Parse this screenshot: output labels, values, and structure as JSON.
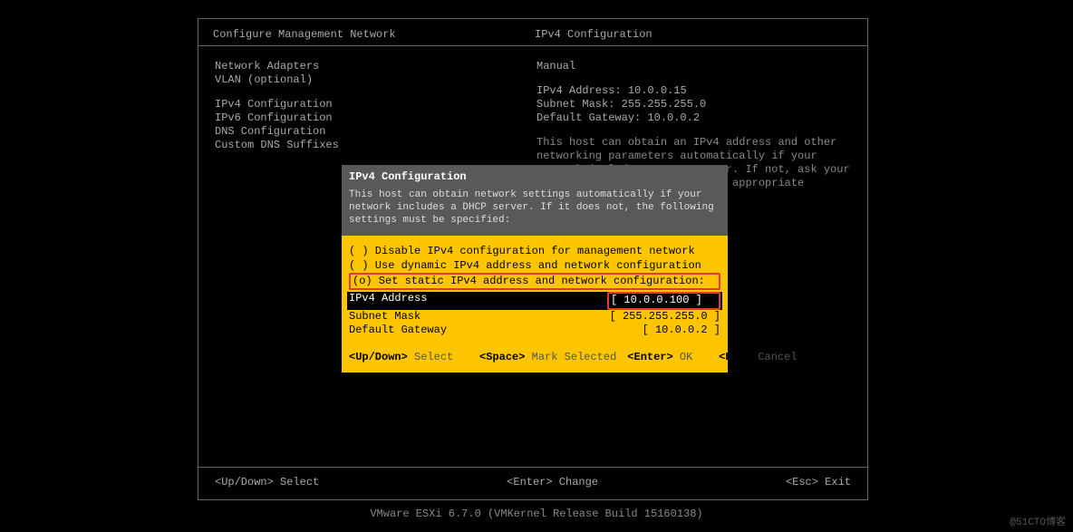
{
  "header": {
    "left": "Configure Management Network",
    "right": "IPv4 Configuration"
  },
  "menu": {
    "items": [
      "Network Adapters",
      "VLAN (optional)",
      "",
      "IPv4 Configuration",
      "IPv6 Configuration",
      "DNS Configuration",
      "Custom DNS Suffixes"
    ]
  },
  "info": {
    "mode": "Manual",
    "addr_label": "IPv4 Address: ",
    "addr_val": "10.0.0.15",
    "mask_label": "Subnet Mask: ",
    "mask_val": "255.255.255.0",
    "gw_label": "Default Gateway: ",
    "gw_val": "10.0.0.2",
    "desc": "This host can obtain an IPv4 address and other networking parameters automatically if your network includes a DHCP server. If not, ask your network administrator for the appropriate settings."
  },
  "dialog": {
    "title": "IPv4 Configuration",
    "subtitle": "This host can obtain network settings automatically if your network includes a DHCP server. If it does not, the following settings must be specified:",
    "opt_disable": "( ) Disable IPv4 configuration for management network",
    "opt_dynamic": "( ) Use dynamic IPv4 address and network configuration",
    "opt_static": "(o) Set static IPv4 address and network configuration:",
    "fields": {
      "addr_label": "IPv4 Address",
      "addr_val": "[ 10.0.0.100          ]",
      "mask_label": "Subnet Mask",
      "mask_val": "[ 255.255.255.0       ]",
      "gw_label": "Default Gateway",
      "gw_val": "[ 10.0.0.2            ]"
    },
    "footer": {
      "updown_key": "<Up/Down>",
      "updown_lbl": " Select",
      "space_key": "<Space>",
      "space_lbl": " Mark Selected",
      "enter_key": "<Enter>",
      "enter_lbl": " OK",
      "esc_key": "<Esc>",
      "esc_lbl": " Cancel"
    }
  },
  "bottom": {
    "updown_key": "<Up/Down>",
    "updown_lbl": " Select",
    "enter_key": "<Enter>",
    "enter_lbl": " Change",
    "esc_key": "<Esc>",
    "esc_lbl": " Exit"
  },
  "version": "VMware ESXi 6.7.0 (VMKernel Release Build 15160138)",
  "watermark": "@51CTO博客"
}
